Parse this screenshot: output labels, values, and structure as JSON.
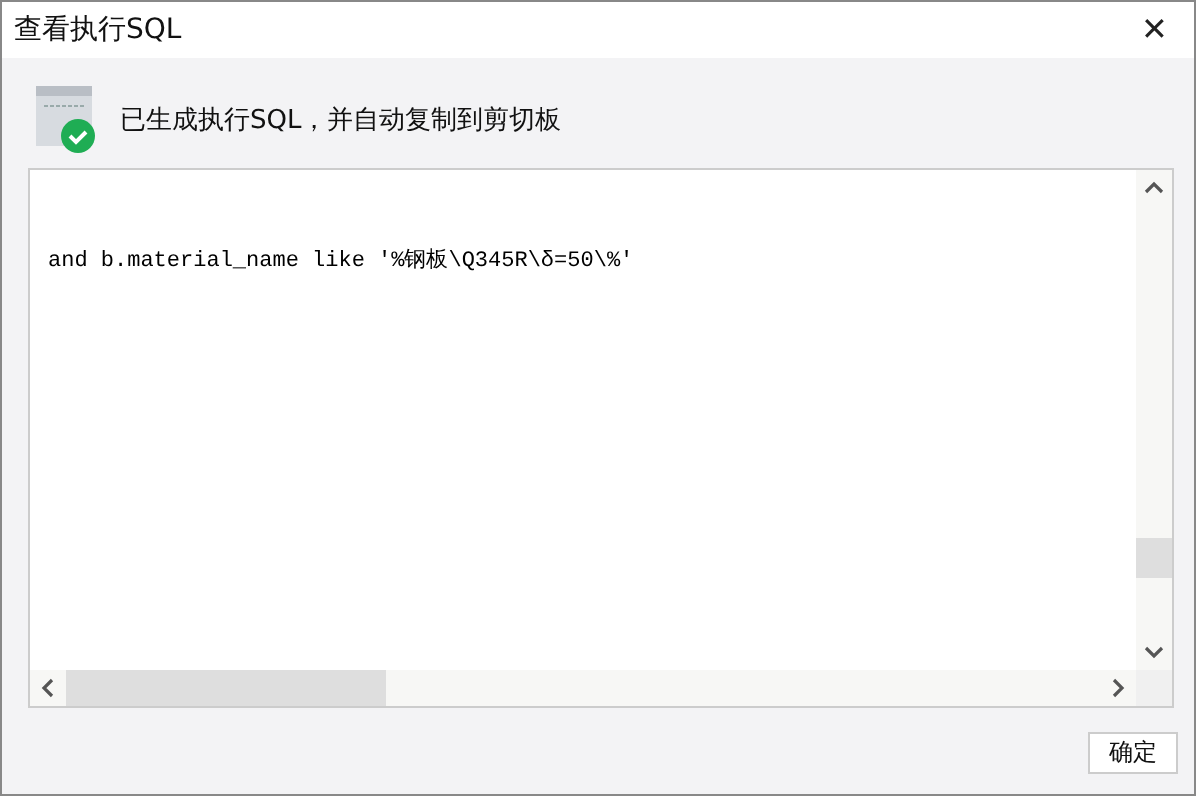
{
  "window": {
    "title": "查看执行SQL",
    "close": "✕"
  },
  "message": "已生成执行SQL，并自动复制到剪切板",
  "sql_text": "and b.material_name like '%钢板\\Q345R\\δ=50\\%'",
  "buttons": [
    "确定"
  ]
}
